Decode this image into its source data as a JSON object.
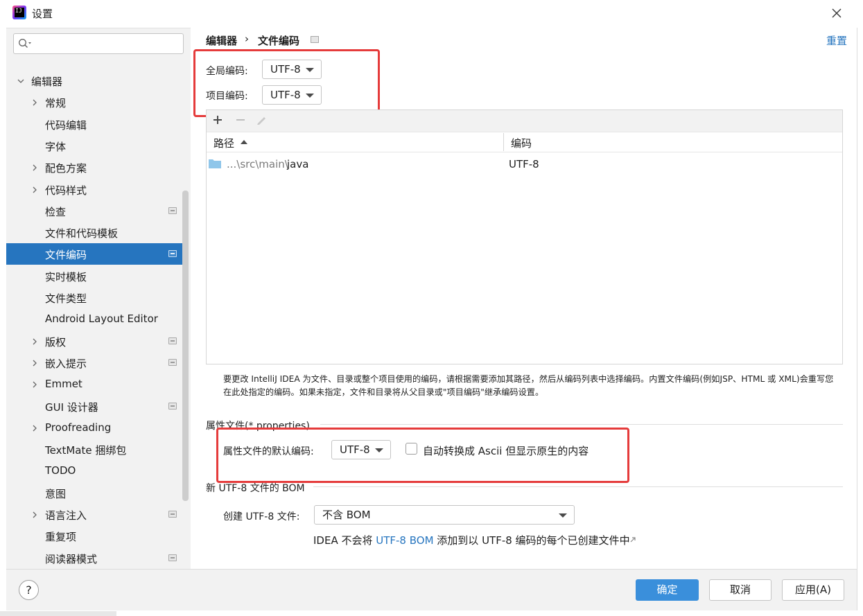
{
  "window": {
    "title": "设置",
    "logo_text": "IJ"
  },
  "sidebar": {
    "search_placeholder": "",
    "items": [
      {
        "label": "编辑器",
        "expandable": true,
        "expanded": true,
        "indent": 0,
        "pinned": false,
        "selected": false
      },
      {
        "label": "常规",
        "expandable": true,
        "expanded": false,
        "indent": 1,
        "pinned": false,
        "selected": false
      },
      {
        "label": "代码编辑",
        "expandable": false,
        "indent": 1,
        "pinned": false,
        "selected": false
      },
      {
        "label": "字体",
        "expandable": false,
        "indent": 1,
        "pinned": false,
        "selected": false
      },
      {
        "label": "配色方案",
        "expandable": true,
        "expanded": false,
        "indent": 1,
        "pinned": false,
        "selected": false
      },
      {
        "label": "代码样式",
        "expandable": true,
        "expanded": false,
        "indent": 1,
        "pinned": false,
        "selected": false
      },
      {
        "label": "检查",
        "expandable": false,
        "indent": 1,
        "pinned": true,
        "selected": false
      },
      {
        "label": "文件和代码模板",
        "expandable": false,
        "indent": 1,
        "pinned": false,
        "selected": false
      },
      {
        "label": "文件编码",
        "expandable": false,
        "indent": 1,
        "pinned": true,
        "selected": true
      },
      {
        "label": "实时模板",
        "expandable": false,
        "indent": 1,
        "pinned": false,
        "selected": false
      },
      {
        "label": "文件类型",
        "expandable": false,
        "indent": 1,
        "pinned": false,
        "selected": false
      },
      {
        "label": "Android Layout Editor",
        "expandable": false,
        "indent": 1,
        "pinned": false,
        "selected": false
      },
      {
        "label": "版权",
        "expandable": true,
        "expanded": false,
        "indent": 1,
        "pinned": true,
        "selected": false
      },
      {
        "label": "嵌入提示",
        "expandable": true,
        "expanded": false,
        "indent": 1,
        "pinned": true,
        "selected": false
      },
      {
        "label": "Emmet",
        "expandable": true,
        "expanded": false,
        "indent": 1,
        "pinned": false,
        "selected": false
      },
      {
        "label": "GUI 设计器",
        "expandable": false,
        "indent": 1,
        "pinned": true,
        "selected": false
      },
      {
        "label": "Proofreading",
        "expandable": true,
        "expanded": false,
        "indent": 1,
        "pinned": false,
        "selected": false
      },
      {
        "label": "TextMate 捆绑包",
        "expandable": false,
        "indent": 1,
        "pinned": false,
        "selected": false
      },
      {
        "label": "TODO",
        "expandable": false,
        "indent": 1,
        "pinned": false,
        "selected": false
      },
      {
        "label": "意图",
        "expandable": false,
        "indent": 1,
        "pinned": false,
        "selected": false
      },
      {
        "label": "语言注入",
        "expandable": true,
        "expanded": false,
        "indent": 1,
        "pinned": true,
        "selected": false
      },
      {
        "label": "重复项",
        "expandable": false,
        "indent": 1,
        "pinned": false,
        "selected": false
      },
      {
        "label": "阅读器模式",
        "expandable": false,
        "indent": 1,
        "pinned": true,
        "selected": false
      }
    ]
  },
  "breadcrumb": {
    "parent": "编辑器",
    "separator": "›",
    "current": "文件编码"
  },
  "reset_label": "重置",
  "global_encoding": {
    "label": "全局编码:",
    "value": "UTF-8"
  },
  "project_encoding": {
    "label": "项目编码:",
    "value": "UTF-8"
  },
  "table": {
    "toolbar": [
      "add",
      "remove",
      "edit"
    ],
    "columns": {
      "path": "路径",
      "encoding": "编码"
    },
    "rows": [
      {
        "path_prefix": "...\\src\\main\\",
        "path_leaf": "java",
        "encoding": "UTF-8"
      }
    ]
  },
  "help_text": "要更改 IntelliJ IDEA 为文件、目录或整个项目使用的编码，请根据需要添加其路径，然后从编码列表中选择编码。内置文件编码(例如JSP、HTML 或 XML)会重写您在此处指定的编码。如果未指定，文件和目录将从父目录或\"项目编码\"继承编码设置。",
  "properties_section": {
    "title": "属性文件(*.properties)",
    "default_label": "属性文件的默认编码:",
    "default_value": "UTF-8",
    "checkbox_label": "自动转换成 Ascii 但显示原生的内容",
    "checkbox_checked": false
  },
  "bom_section": {
    "title": "新 UTF-8 文件的 BOM",
    "create_label": "创建 UTF-8 文件:",
    "create_value": "不含 BOM",
    "desc_prefix": "IDEA 不会将 ",
    "desc_link": "UTF-8 BOM",
    "desc_suffix": " 添加到以 UTF-8 编码的每个已创建文件中"
  },
  "footer": {
    "help": "?",
    "ok": "确定",
    "cancel": "取消",
    "apply": "应用(A)"
  },
  "colors": {
    "accent": "#2675bf",
    "primary_button": "#3a8fdb",
    "highlight_box": "#e53b3b"
  }
}
